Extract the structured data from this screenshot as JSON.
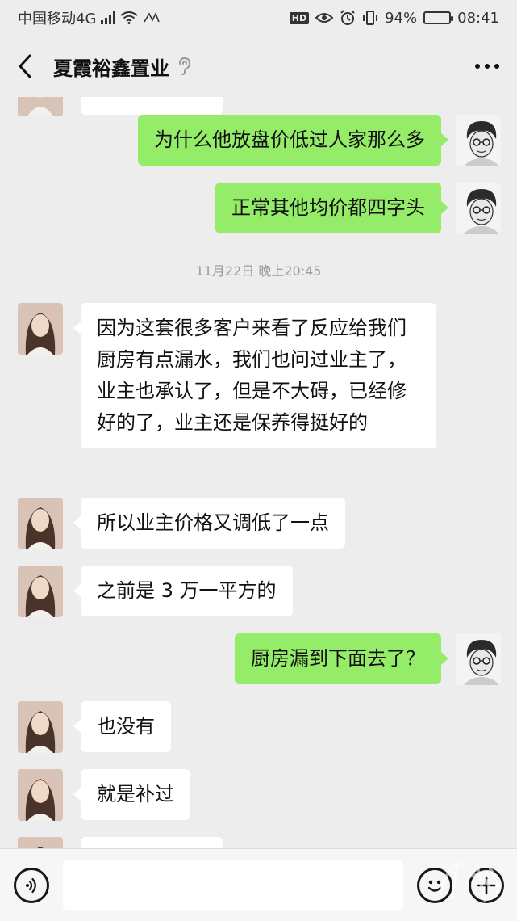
{
  "status_bar": {
    "carrier": "中国移动4G",
    "network_badge": "4G",
    "hd_label": "HD",
    "battery_percent": "94%",
    "battery_level": 0.94,
    "time": "08:41",
    "icons": [
      "signal-bars-icon",
      "wifi-icon",
      "nfc-icon",
      "eye-icon",
      "alarm-icon",
      "vibrate-icon",
      "battery-icon"
    ]
  },
  "nav": {
    "title": "夏霞裕鑫置业",
    "back_icon": "chevron-left-icon",
    "mute_icon": "ear-icon",
    "more_icon": "more-dots-icon"
  },
  "chat": {
    "timestamp": "11月22日 晚上20:45",
    "messages": [
      {
        "sender": "contact",
        "text": ""
      },
      {
        "sender": "self",
        "text": "为什么他放盘价低过人家那么多"
      },
      {
        "sender": "self",
        "text": "正常其他均价都四字头"
      },
      {
        "sender": "contact",
        "text": "因为这套很多客户来看了反应给我们厨房有点漏水，我们也问过业主了，业主也承认了，但是不大碍，已经修好的了，业主还是保养得挺好的"
      },
      {
        "sender": "contact",
        "text": "所以业主价格又调低了一点"
      },
      {
        "sender": "contact",
        "text": "之前是 3 万一平方的"
      },
      {
        "sender": "self",
        "text": "厨房漏到下面去了？"
      },
      {
        "sender": "contact",
        "text": "也没有"
      },
      {
        "sender": "contact",
        "text": "就是补过"
      },
      {
        "sender": "contact",
        "text": ""
      }
    ]
  },
  "input_bar": {
    "voice_icon": "voice-icon",
    "emoji_icon": "emoji-icon",
    "plus_icon": "plus-icon",
    "input_value": ""
  },
  "colors": {
    "background": "#ededed",
    "outgoing_bubble": "#95ec69",
    "incoming_bubble": "#ffffff"
  }
}
